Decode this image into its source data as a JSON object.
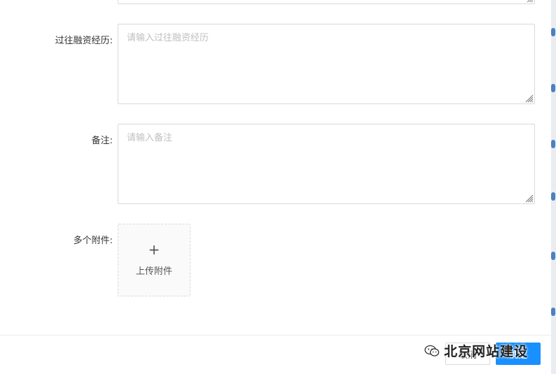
{
  "form": {
    "financing_history": {
      "label": "过往融资经历:",
      "placeholder": "请输入过往融资经历"
    },
    "remarks": {
      "label": "备注:",
      "placeholder": "请输入备注"
    },
    "attachments": {
      "label": "多个附件:",
      "upload_icon": "plus-icon",
      "upload_text": "上传附件"
    }
  },
  "footer": {
    "cancel_label": "取消",
    "ok_label": "确定"
  },
  "watermark": {
    "icon": "wechat-icon",
    "text": "北京网站建设"
  },
  "colors": {
    "primary": "#1890ff",
    "border": "#d9d9d9",
    "placeholder": "#bfbfbf",
    "label": "#333333"
  }
}
